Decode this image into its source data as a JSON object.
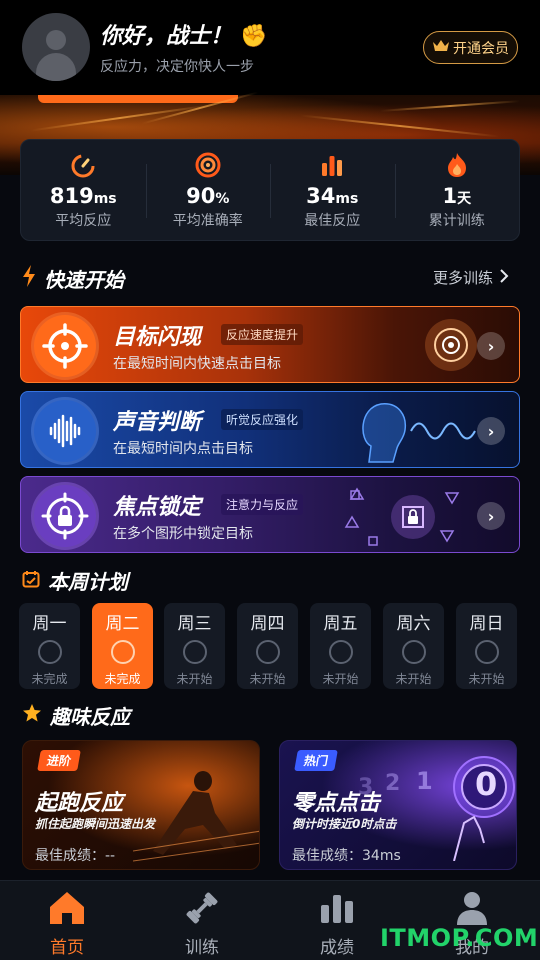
{
  "header": {
    "greeting": "你好，战士！",
    "greeting_emoji": "✊",
    "slogan": "反应力，决定你快人一步",
    "vip_label": "开通会员"
  },
  "stats": [
    {
      "icon": "speedometer-icon",
      "value": "819",
      "unit": "ms",
      "label": "平均反应"
    },
    {
      "icon": "target-icon",
      "value": "90",
      "unit": "%",
      "label": "平均准确率"
    },
    {
      "icon": "bar-chart-icon",
      "value": "34",
      "unit": "ms",
      "label": "最佳反应"
    },
    {
      "icon": "flame-icon",
      "value": "1",
      "unit": "天",
      "label": "累计训练"
    }
  ],
  "quick_start": {
    "title": "快速开始",
    "more": "更多训练"
  },
  "trainings": [
    {
      "title": "目标闪现",
      "tag": "反应速度提升",
      "desc": "在最短时间内快速点击目标"
    },
    {
      "title": "声音判断",
      "tag": "听觉反应强化",
      "desc": "在最短时间内点击目标"
    },
    {
      "title": "焦点锁定",
      "tag": "注意力与反应",
      "desc": "在多个图形中锁定目标"
    }
  ],
  "week_plan": {
    "title": "本周计划",
    "days": [
      {
        "name": "周一",
        "status": "未完成"
      },
      {
        "name": "周二",
        "status": "未完成"
      },
      {
        "name": "周三",
        "status": "未开始"
      },
      {
        "name": "周四",
        "status": "未开始"
      },
      {
        "name": "周五",
        "status": "未开始"
      },
      {
        "name": "周六",
        "status": "未开始"
      },
      {
        "name": "周日",
        "status": "未开始"
      }
    ]
  },
  "fun": {
    "title": "趣味反应",
    "cards": [
      {
        "badge": "进阶",
        "title": "起跑反应",
        "subtitle": "抓住起跑瞬间迅速出发",
        "best": "最佳成绩：--"
      },
      {
        "badge": "热门",
        "title": "零点点击",
        "subtitle": "倒计时接近0时点击",
        "best": "最佳成绩：34ms",
        "digits": [
          "3",
          "2",
          "1",
          "0"
        ]
      }
    ]
  },
  "tabs": [
    {
      "label": "首页"
    },
    {
      "label": "训练"
    },
    {
      "label": "成绩"
    },
    {
      "label": "我的"
    }
  ],
  "watermark": "ITMOP.COM",
  "colors": {
    "accent": "#ff6a1a",
    "blue_card": "#1a4aa8",
    "purple_card": "#4b2a8c",
    "gold": "#d49a45"
  }
}
